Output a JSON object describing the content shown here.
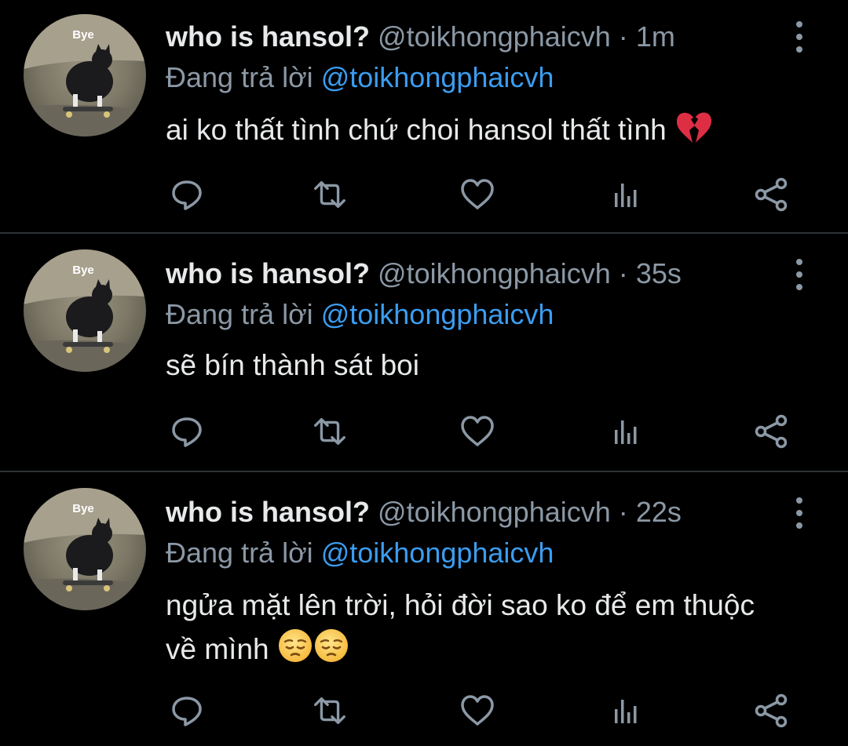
{
  "colors": {
    "background": "#000000",
    "text": "#e7e9ea",
    "muted": "#8b98a5",
    "link": "#3b9df0",
    "divider": "#2f3336"
  },
  "tweets": [
    {
      "avatar_badge": "Bye",
      "name": "who is hansol?",
      "handle": "@toikhongphaicvh",
      "separator": "·",
      "time": "1m",
      "reply_prefix": "Đang trả lời",
      "reply_handle": "@toikhongphaicvh",
      "text": "ai ko thất tình chứ choi hansol thất tình",
      "emoji_icons": [
        "broken-heart-icon"
      ]
    },
    {
      "avatar_badge": "Bye",
      "name": "who is hansol?",
      "handle": "@toikhongphaicvh",
      "separator": "·",
      "time": "35s",
      "reply_prefix": "Đang trả lời",
      "reply_handle": "@toikhongphaicvh",
      "text": "sẽ bín thành sát boi",
      "emoji_icons": []
    },
    {
      "avatar_badge": "Bye",
      "name": "who is hansol?",
      "handle": "@toikhongphaicvh",
      "separator": "·",
      "time": "22s",
      "reply_prefix": "Đang trả lời",
      "reply_handle": "@toikhongphaicvh",
      "text": "ngửa mặt lên trời, hỏi đời sao ko để em thuộc về mình",
      "emoji_icons": [
        "pensive-face-icon",
        "pensive-face-icon"
      ]
    }
  ],
  "action_icons": [
    "reply-icon",
    "retweet-icon",
    "like-icon",
    "analytics-icon",
    "share-icon"
  ]
}
